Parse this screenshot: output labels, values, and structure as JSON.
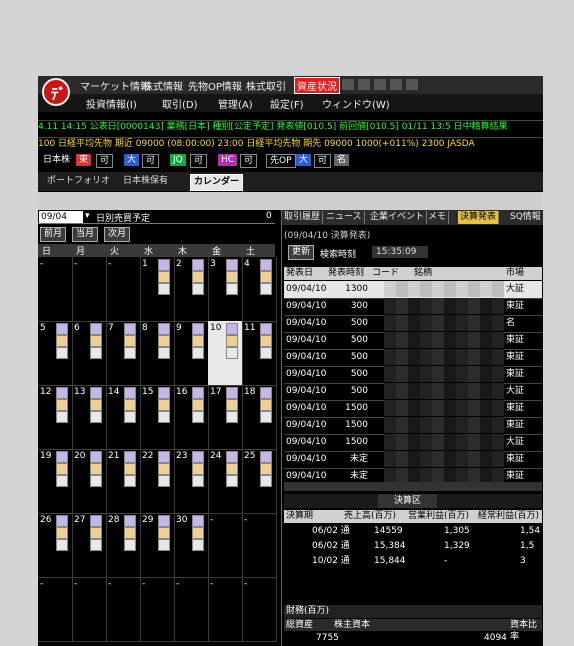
{
  "menus_top": [
    "マーケット情報",
    "株式情報",
    "先物OP情報",
    "株式取引",
    "資産状況"
  ],
  "menus_bottom": [
    "投資情報(I)",
    "取引(D)",
    "管理(A)",
    "設定(F)",
    "ウィンドウ(W)"
  ],
  "ticker1": "4.11 14:15 公表日[0000143] 業務[日本] 種別[公定予定] 発表値[010.5] 前回値[010.5]   01/11 13:5 日中精算結果",
  "ticker2": "100   日経平均先物 期近 09000 (08:00:00) 23:00   日経平均先物 期先 09000 1000(+011%) 2300   JASDA",
  "index_row": {
    "label": "日本株",
    "chips": [
      "東",
      "可",
      "大",
      "可",
      "JQ",
      "可",
      "HC",
      "可",
      "先OP",
      "大",
      "可",
      "名"
    ]
  },
  "tabs": [
    "ポートフォリオ",
    "日本株保有",
    "カレンダー"
  ],
  "calendar": {
    "date_value": "09/04",
    "select_label": "日別売買予定",
    "count": "0",
    "buttons": [
      "前月",
      "当月",
      "次月"
    ],
    "dow": [
      "日",
      "月",
      "火",
      "水",
      "木",
      "金",
      "土"
    ],
    "weeks": [
      [
        "-",
        "-",
        "-",
        "1",
        "2",
        "3",
        "4"
      ],
      [
        "5",
        "6",
        "7",
        "8",
        "9",
        "10",
        "11"
      ],
      [
        "12",
        "13",
        "14",
        "15",
        "16",
        "17",
        "18"
      ],
      [
        "19",
        "20",
        "21",
        "22",
        "23",
        "24",
        "25"
      ],
      [
        "26",
        "27",
        "28",
        "29",
        "30",
        "-",
        "-"
      ],
      [
        "-",
        "-",
        "-",
        "-",
        "-",
        "-",
        "-"
      ]
    ]
  },
  "right": {
    "tabs": [
      "取引履歴",
      "ニュース",
      "企業イベント",
      "メモ",
      "決算発表",
      "SQ情報"
    ],
    "subtitle": "(09/04/10 決算発表)",
    "refresh_label": "更新",
    "search_label": "検索時刻",
    "search_value": "15:35:09",
    "headers": [
      "発表日",
      "発表時刻",
      "コード",
      "銘柄",
      "市場"
    ],
    "rows": [
      {
        "date": "09/04/10",
        "time": "1300",
        "mkt": "大証"
      },
      {
        "date": "09/04/10",
        "time": "300",
        "mkt": "東証"
      },
      {
        "date": "09/04/10",
        "time": "500",
        "mkt": "名"
      },
      {
        "date": "09/04/10",
        "time": "500",
        "mkt": "東証"
      },
      {
        "date": "09/04/10",
        "time": "500",
        "mkt": "東証"
      },
      {
        "date": "09/04/10",
        "time": "500",
        "mkt": "東証"
      },
      {
        "date": "09/04/10",
        "time": "500",
        "mkt": "大証"
      },
      {
        "date": "09/04/10",
        "time": "1500",
        "mkt": "東証"
      },
      {
        "date": "09/04/10",
        "time": "1500",
        "mkt": "東証"
      },
      {
        "date": "09/04/10",
        "time": "1500",
        "mkt": "大証"
      },
      {
        "date": "09/04/10",
        "time": "未定",
        "mkt": "東証"
      },
      {
        "date": "09/04/10",
        "time": "未定",
        "mkt": "東証"
      }
    ],
    "kessan_label": "決算区",
    "fin_headers": [
      "決算期",
      "売上高(百万)",
      "営業利益(百万)",
      "経常利益(百万)"
    ],
    "fin_rows": [
      {
        "period": "06/02 通",
        "sales": "14559",
        "op": "1,305",
        "ord": "1,54"
      },
      {
        "period": "06/02 通",
        "sales": "15,384",
        "op": "1,329",
        "ord": "1,5"
      },
      {
        "period": "10/02 通",
        "sales": "15,844",
        "op": "-",
        "ord": "3"
      }
    ],
    "asset_title": "財務(百万)",
    "asset_headers": [
      "総資産",
      "株主資本",
      "資本比率"
    ],
    "asset_values": [
      "7755",
      "",
      "4094"
    ]
  }
}
